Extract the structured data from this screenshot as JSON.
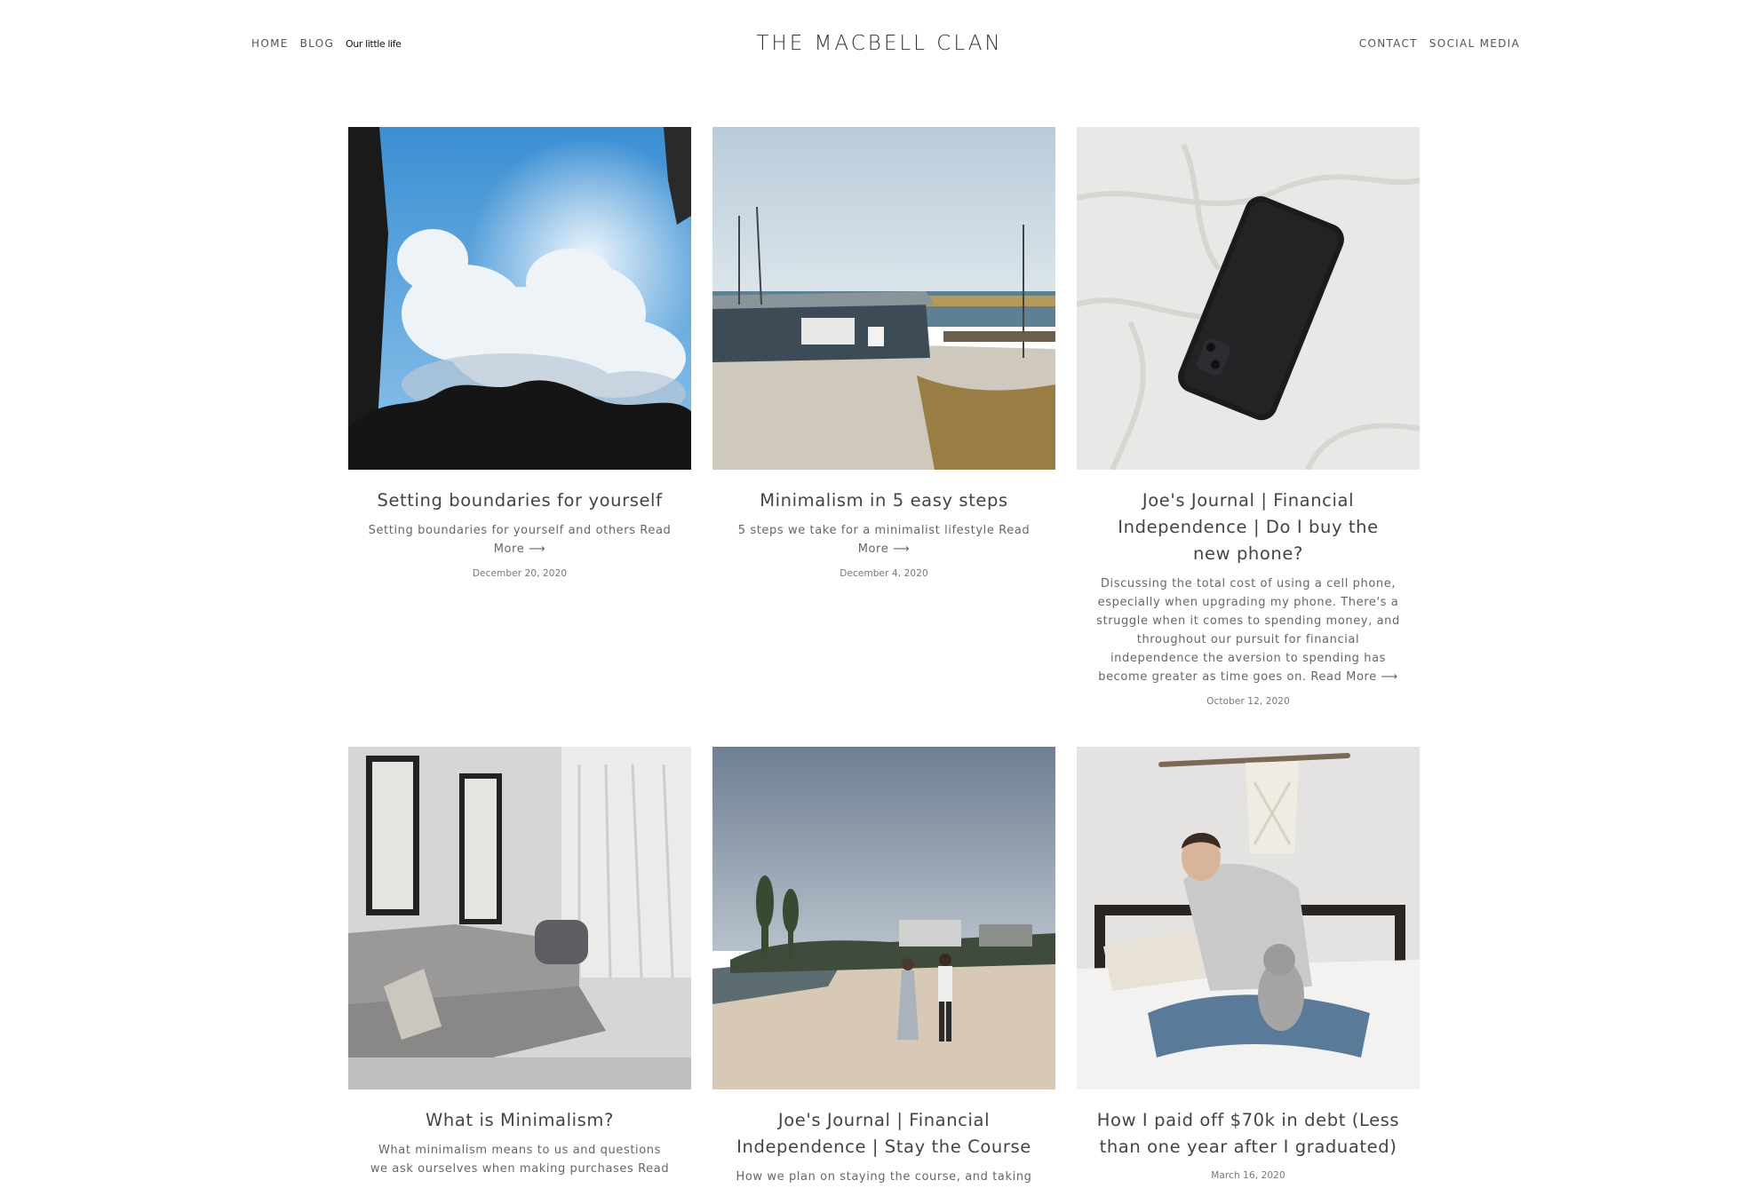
{
  "header": {
    "nav_left": [
      {
        "label": "HOME"
      },
      {
        "label": "BLOG"
      },
      {
        "label": "Our little life"
      }
    ],
    "site_title": "THE MACBELL CLAN",
    "nav_right": [
      {
        "label": "CONTACT"
      },
      {
        "label": "SOCIAL MEDIA"
      }
    ]
  },
  "posts": [
    {
      "title": "Setting boundaries for yourself",
      "excerpt": "Setting boundaries for yourself and others Read More ⟶",
      "date": "December 20, 2020"
    },
    {
      "title": "Minimalism in 5 easy steps",
      "excerpt": "5 steps we take for a minimalist lifestyle Read More ⟶",
      "date": "December 4, 2020"
    },
    {
      "title": "Joe's Journal | Financial Independence | Do I buy the new phone?",
      "excerpt": "Discussing the total cost of using a cell phone, especially when upgrading my phone. There's a struggle when it comes to spending money, and throughout our pursuit for financial independence the aversion to spending has become greater as time goes on. Read More ⟶",
      "date": "October 12, 2020"
    },
    {
      "title": "What is Minimalism?",
      "excerpt": "What minimalism means to us and questions we ask ourselves when making purchases Read",
      "date": ""
    },
    {
      "title": "Joe's Journal | Financial Independence | Stay the Course",
      "excerpt": "How we plan on staying the course, and taking",
      "date": ""
    },
    {
      "title": "How I paid off $70k in debt (Less than one year after I graduated)",
      "excerpt": "",
      "date": "March 16, 2020"
    }
  ]
}
